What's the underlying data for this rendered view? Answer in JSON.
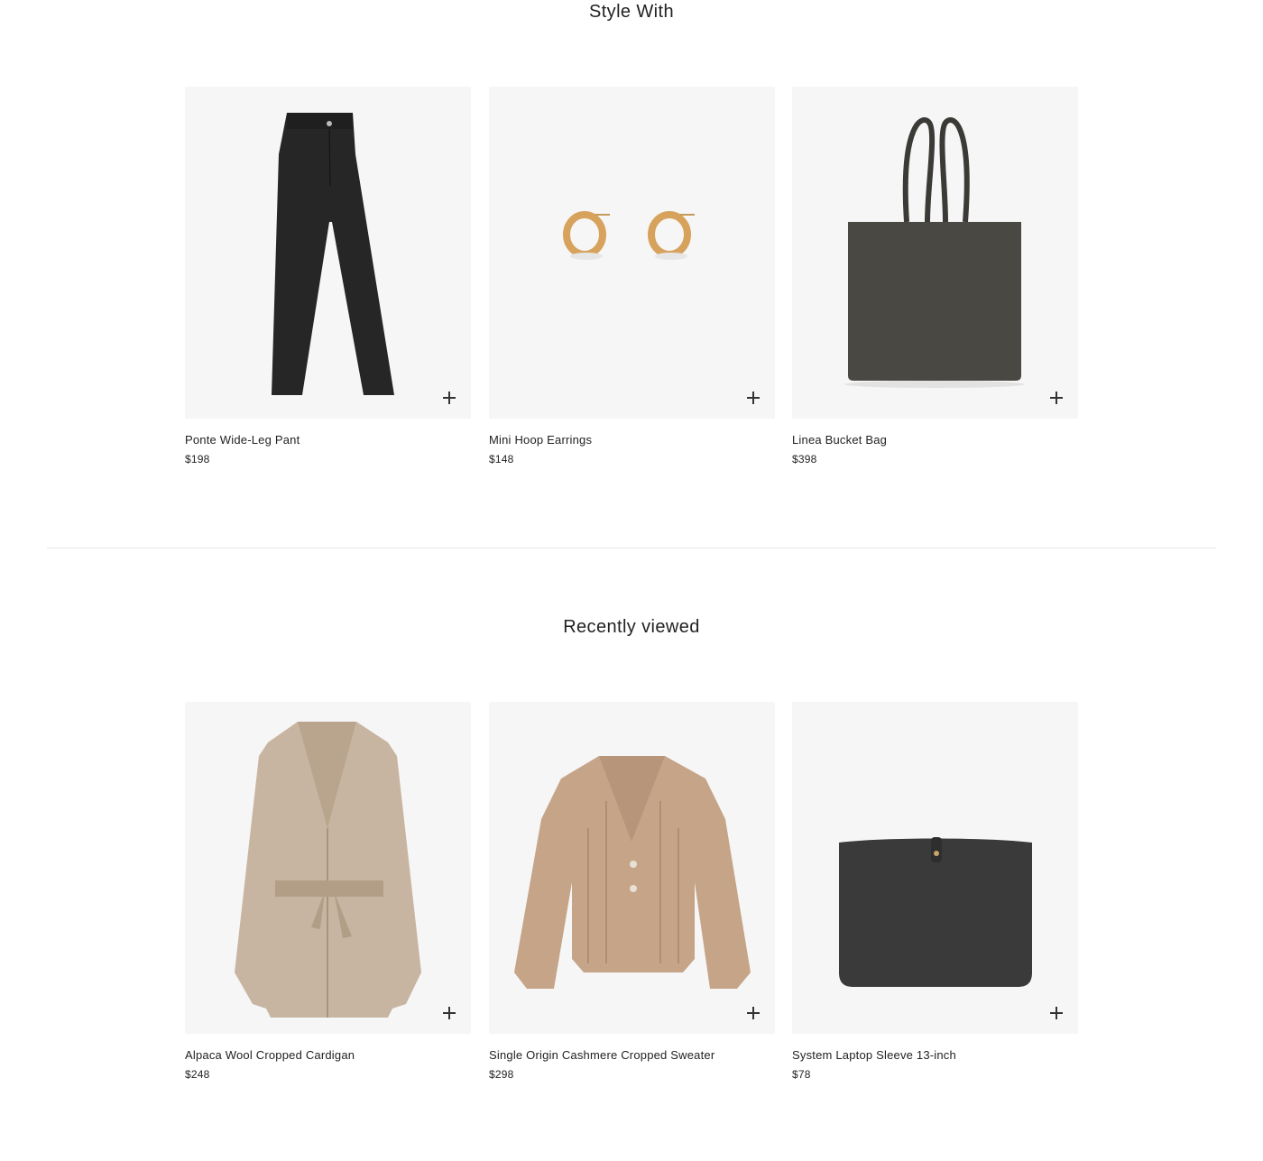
{
  "sections": [
    {
      "title": "Style With",
      "products": [
        {
          "name": "Ponte Wide-Leg Pant",
          "price": "$198",
          "image": "pant-image"
        },
        {
          "name": "Mini Hoop Earrings",
          "price": "$148",
          "image": "earrings-image"
        },
        {
          "name": "Linea Bucket Bag",
          "price": "$398",
          "image": "bag-image"
        }
      ]
    },
    {
      "title": "Recently viewed",
      "products": [
        {
          "name": "Alpaca Wool Cropped Cardigan",
          "price": "$248",
          "image": "coat-image"
        },
        {
          "name": "Single Origin Cashmere Cropped Sweater",
          "price": "$298",
          "image": "cardigan-image"
        },
        {
          "name": "System Laptop Sleeve 13-inch",
          "price": "$78",
          "image": "laptop-sleeve-image"
        }
      ]
    }
  ],
  "icons": {
    "add": "plus-icon"
  },
  "colors": {
    "thumb_bg": "#f6f6f6",
    "text": "#222222",
    "divider": "#e6e6e6"
  }
}
